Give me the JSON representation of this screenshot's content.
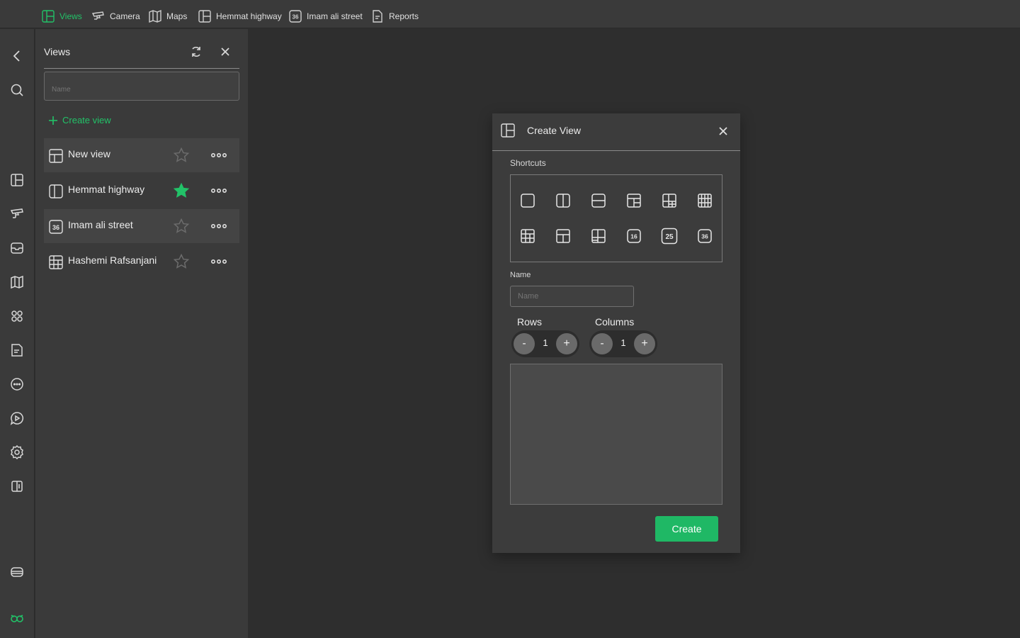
{
  "topbar": {
    "tabs": [
      {
        "label": "Views",
        "icon": "layout-icon",
        "active": true
      },
      {
        "label": "Camera",
        "icon": "cctv-camera-icon",
        "active": false
      },
      {
        "label": "Maps",
        "icon": "map-icon",
        "active": false
      },
      {
        "label": "Hemmat highway",
        "icon": "layout-icon",
        "active": false
      },
      {
        "label": "Imam ali street",
        "icon": "grid-36-icon",
        "active": false
      },
      {
        "label": "Reports",
        "icon": "report-icon",
        "active": false
      }
    ],
    "accent_color": "#22c268"
  },
  "rail": {
    "items": [
      "back-icon",
      "search-icon",
      "layout-icon",
      "cctv-camera-icon",
      "inbox-icon",
      "map-icon",
      "apps-icon",
      "report-icon",
      "chat-icon",
      "video-chat-icon",
      "gear-icon",
      "exit-icon",
      "device-icon",
      "logo-icon"
    ]
  },
  "views_panel": {
    "title": "Views",
    "search_placeholder": "Name",
    "create_label": "Create view",
    "items": [
      {
        "label": "New view",
        "icon": "layout-3-icon",
        "favorite": false
      },
      {
        "label": "Hemmat highway",
        "icon": "layout-2col-icon",
        "favorite": true
      },
      {
        "label": "Imam ali street",
        "icon": "grid-36-icon",
        "icon_text": "36",
        "favorite": false
      },
      {
        "label": "Hashemi Rafsanjani",
        "icon": "grid-9-icon",
        "favorite": false
      }
    ]
  },
  "dialog": {
    "title": "Create View",
    "shortcuts_label": "Shortcuts",
    "shortcut_badges": [
      "16",
      "25",
      "36"
    ],
    "name_label": "Name",
    "name_placeholder": "Name",
    "rows_label": "Rows",
    "columns_label": "Columns",
    "rows_value": "1",
    "columns_value": "1",
    "minus": "-",
    "plus": "+",
    "create_label": "Create",
    "create_color": "#1fb865"
  }
}
